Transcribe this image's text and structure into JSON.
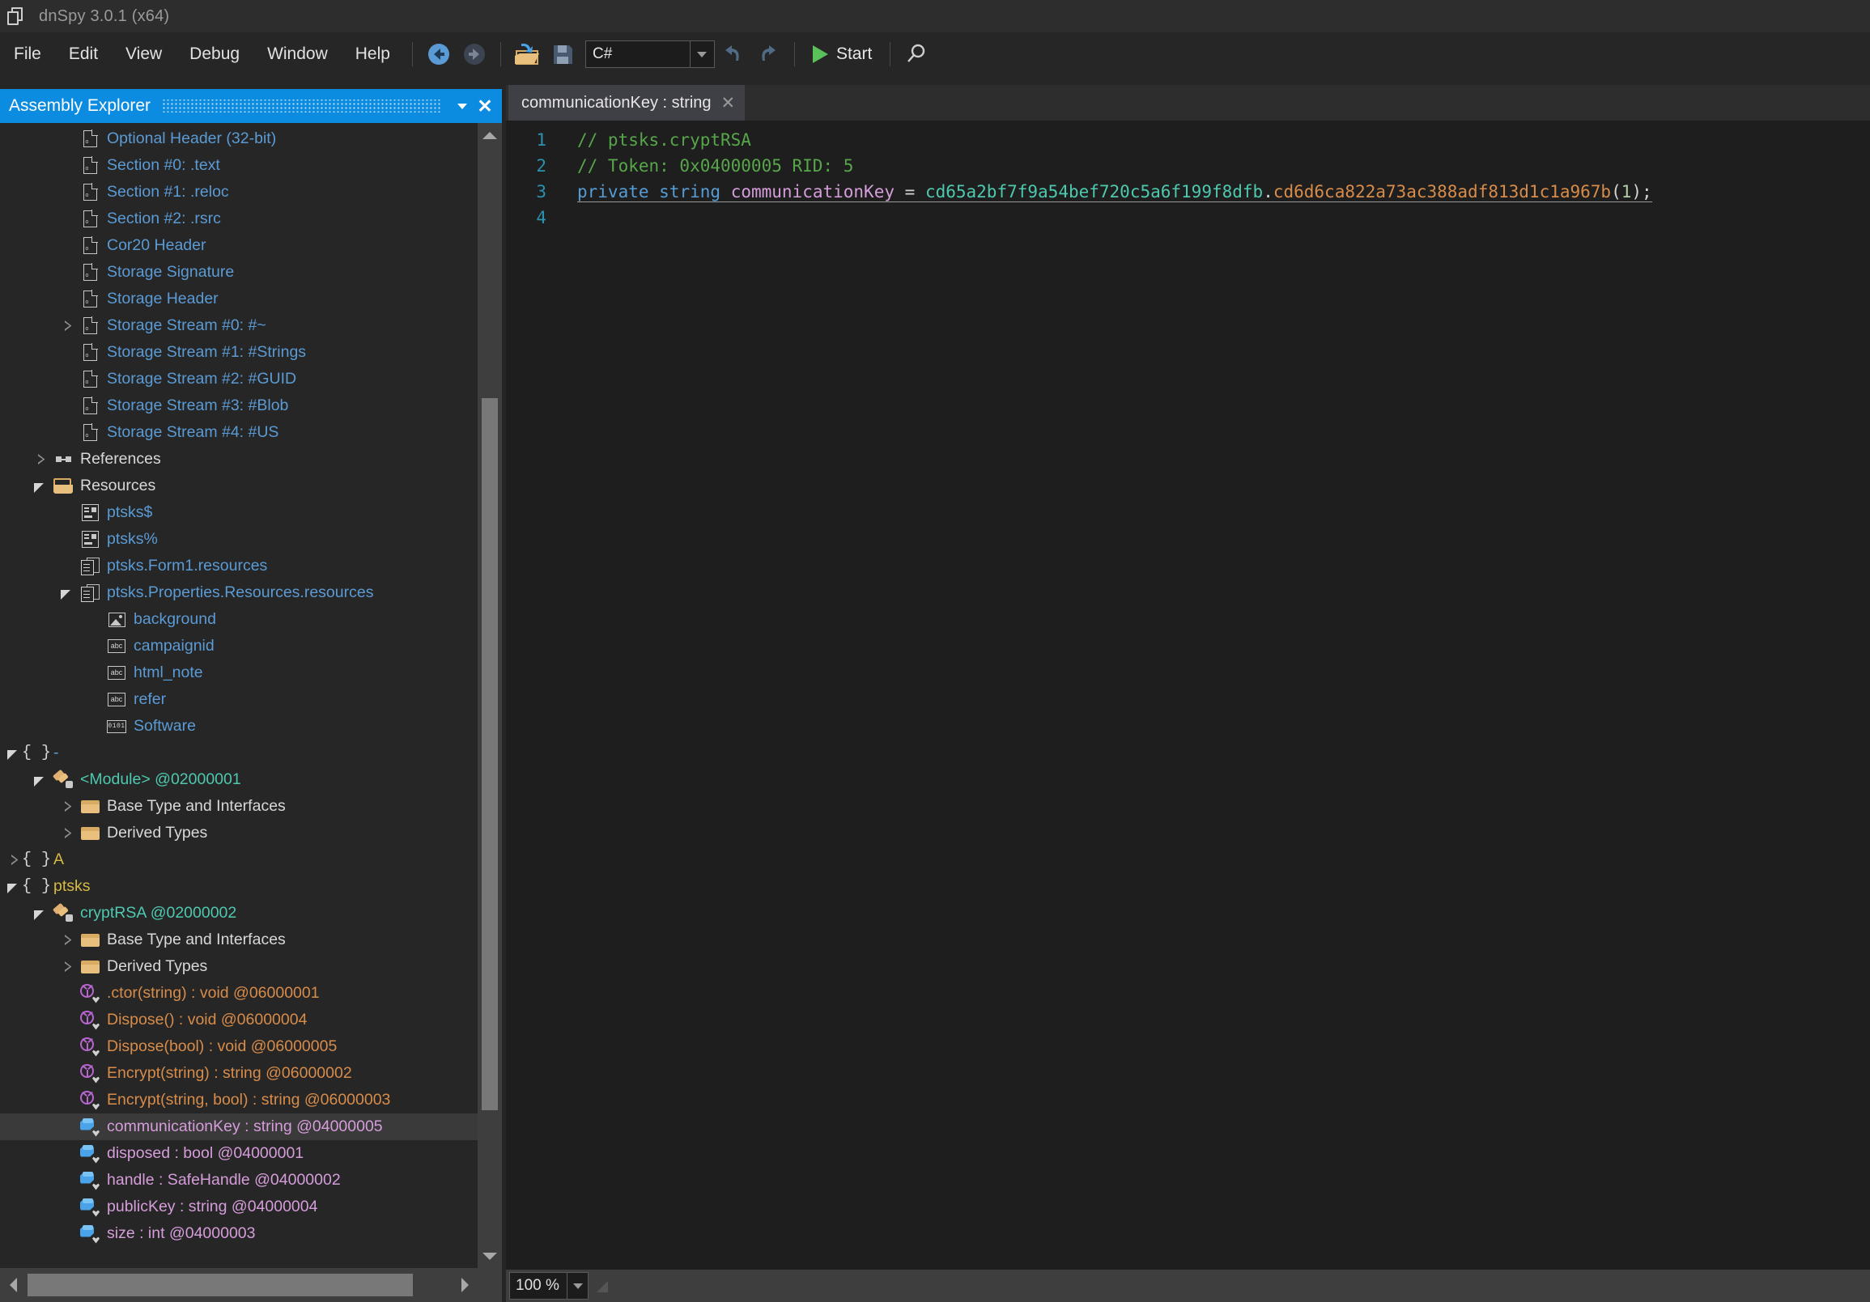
{
  "window": {
    "title": "dnSpy 3.0.1 (x64)",
    "app_icon": "windows-stack-icon"
  },
  "menu": {
    "items": [
      {
        "label": "File"
      },
      {
        "label": "Edit"
      },
      {
        "label": "View"
      },
      {
        "label": "Debug"
      },
      {
        "label": "Window"
      },
      {
        "label": "Help"
      }
    ]
  },
  "toolbar": {
    "back_icon": "back-arrow-icon",
    "forward_icon": "forward-arrow-icon",
    "open_icon": "open-folder-icon",
    "save_icon": "save-disk-icon",
    "language_combo": {
      "value": "C#",
      "caret": "chevron-down-icon"
    },
    "undo_icon": "undo-icon",
    "redo_icon": "redo-icon",
    "start_label": "Start",
    "start_icon": "play-icon",
    "search_icon": "search-icon"
  },
  "left_panel": {
    "title": "Assembly Explorer",
    "menu_icon": "chevron-down-icon",
    "close_icon": "close-icon",
    "tree": [
      {
        "label": "Optional Header (32-bit)",
        "icon": "document-icon",
        "indent": 3,
        "arrow": "none",
        "kind": "doc",
        "color": "#5b9bd5"
      },
      {
        "label": "Section #0: .text",
        "icon": "document-icon",
        "indent": 3,
        "arrow": "none",
        "kind": "doc",
        "color": "#5b9bd5"
      },
      {
        "label": "Section #1: .reloc",
        "icon": "document-icon",
        "indent": 3,
        "arrow": "none",
        "kind": "doc",
        "color": "#5b9bd5"
      },
      {
        "label": "Section #2: .rsrc",
        "icon": "document-icon",
        "indent": 3,
        "arrow": "none",
        "kind": "doc",
        "color": "#5b9bd5"
      },
      {
        "label": "Cor20 Header",
        "icon": "document-icon",
        "indent": 3,
        "arrow": "none",
        "kind": "doc",
        "color": "#5b9bd5"
      },
      {
        "label": "Storage Signature",
        "icon": "document-icon",
        "indent": 3,
        "arrow": "none",
        "kind": "doc",
        "color": "#5b9bd5"
      },
      {
        "label": "Storage Header",
        "icon": "document-icon",
        "indent": 3,
        "arrow": "none",
        "kind": "doc",
        "color": "#5b9bd5"
      },
      {
        "label": "Storage Stream #0: #~",
        "icon": "document-icon",
        "indent": 3,
        "arrow": "collapsed",
        "kind": "doc",
        "color": "#5b9bd5"
      },
      {
        "label": "Storage Stream #1: #Strings",
        "icon": "document-icon",
        "indent": 3,
        "arrow": "none",
        "kind": "doc",
        "color": "#5b9bd5"
      },
      {
        "label": "Storage Stream #2: #GUID",
        "icon": "document-icon",
        "indent": 3,
        "arrow": "none",
        "kind": "doc",
        "color": "#5b9bd5"
      },
      {
        "label": "Storage Stream #3: #Blob",
        "icon": "document-icon",
        "indent": 3,
        "arrow": "none",
        "kind": "doc",
        "color": "#5b9bd5"
      },
      {
        "label": "Storage Stream #4: #US",
        "icon": "document-icon",
        "indent": 3,
        "arrow": "none",
        "kind": "doc",
        "color": "#5b9bd5"
      },
      {
        "label": "References",
        "icon": "references-icon",
        "indent": 2,
        "arrow": "collapsed",
        "kind": "refs",
        "color": "#d8d8d8"
      },
      {
        "label": "Resources",
        "icon": "folder-open-icon",
        "indent": 2,
        "arrow": "expanded",
        "kind": "folderopen",
        "color": "#d8d8d8"
      },
      {
        "label": "ptsks$",
        "icon": "resource-table-icon",
        "indent": 3,
        "arrow": "none",
        "kind": "restable",
        "color": "#5b9bd5"
      },
      {
        "label": "ptsks%",
        "icon": "resource-table-icon",
        "indent": 3,
        "arrow": "none",
        "kind": "restable",
        "color": "#5b9bd5"
      },
      {
        "label": "ptsks.Form1.resources",
        "icon": "multi-document-icon",
        "indent": 3,
        "arrow": "none",
        "kind": "multidoc",
        "color": "#5b9bd5"
      },
      {
        "label": "ptsks.Properties.Resources.resources",
        "icon": "multi-document-icon",
        "indent": 3,
        "arrow": "expanded",
        "kind": "multidoc",
        "color": "#5b9bd5"
      },
      {
        "label": "background",
        "icon": "image-icon",
        "indent": 4,
        "arrow": "none",
        "kind": "image",
        "color": "#5b9bd5"
      },
      {
        "label": "campaignid",
        "icon": "abc-string-icon",
        "indent": 4,
        "arrow": "none",
        "kind": "abc",
        "color": "#5b9bd5"
      },
      {
        "label": "html_note",
        "icon": "abc-string-icon",
        "indent": 4,
        "arrow": "none",
        "kind": "abc",
        "color": "#5b9bd5"
      },
      {
        "label": "refer",
        "icon": "abc-string-icon",
        "indent": 4,
        "arrow": "none",
        "kind": "abc",
        "color": "#5b9bd5"
      },
      {
        "label": "Software",
        "icon": "binary-icon",
        "indent": 4,
        "arrow": "none",
        "kind": "binary",
        "color": "#5b9bd5"
      },
      {
        "label": "-",
        "icon": "namespace-icon",
        "indent": 1,
        "arrow": "expanded",
        "kind": "ns",
        "color": "#5b9bd5"
      },
      {
        "label": "<Module> @02000001",
        "icon": "class-icon",
        "indent": 2,
        "arrow": "expanded",
        "kind": "class",
        "color": "#4ec9b0"
      },
      {
        "label": "Base Type and Interfaces",
        "icon": "folder-icon",
        "indent": 3,
        "arrow": "collapsed",
        "kind": "folder",
        "color": "#d8d8d8"
      },
      {
        "label": "Derived Types",
        "icon": "folder-icon",
        "indent": 3,
        "arrow": "collapsed",
        "kind": "folder",
        "color": "#d8d8d8"
      },
      {
        "label": "A",
        "icon": "namespace-icon",
        "indent": 1,
        "arrow": "collapsed",
        "kind": "ns",
        "color": "#d7ba45"
      },
      {
        "label": "ptsks",
        "icon": "namespace-icon",
        "indent": 1,
        "arrow": "expanded",
        "kind": "ns",
        "color": "#d7ba45"
      },
      {
        "label": "cryptRSA @02000002",
        "icon": "class-icon",
        "indent": 2,
        "arrow": "expanded",
        "kind": "class",
        "color": "#4ec9b0"
      },
      {
        "label": "Base Type and Interfaces",
        "icon": "folder-icon",
        "indent": 3,
        "arrow": "collapsed",
        "kind": "folder",
        "color": "#d8d8d8"
      },
      {
        "label": "Derived Types",
        "icon": "folder-icon",
        "indent": 3,
        "arrow": "collapsed",
        "kind": "folder",
        "color": "#d8d8d8"
      },
      {
        "label": ".ctor(string) : void @06000001",
        "icon": "method-icon",
        "indent": 3,
        "arrow": "none",
        "kind": "method",
        "color": "#d88c4a"
      },
      {
        "label": "Dispose() : void @06000004",
        "icon": "method-icon",
        "indent": 3,
        "arrow": "none",
        "kind": "method",
        "color": "#d88c4a"
      },
      {
        "label": "Dispose(bool) : void @06000005",
        "icon": "method-icon",
        "indent": 3,
        "arrow": "none",
        "kind": "method",
        "color": "#d88c4a"
      },
      {
        "label": "Encrypt(string) : string @06000002",
        "icon": "method-icon",
        "indent": 3,
        "arrow": "none",
        "kind": "method",
        "color": "#d88c4a"
      },
      {
        "label": "Encrypt(string, bool) : string @06000003",
        "icon": "method-icon",
        "indent": 3,
        "arrow": "none",
        "kind": "method",
        "color": "#d88c4a"
      },
      {
        "label": "communicationKey : string @04000005",
        "icon": "field-icon",
        "indent": 3,
        "arrow": "none",
        "kind": "field",
        "color": "#d69ddb",
        "selected": true
      },
      {
        "label": "disposed : bool @04000001",
        "icon": "field-icon",
        "indent": 3,
        "arrow": "none",
        "kind": "field",
        "color": "#d69ddb"
      },
      {
        "label": "handle : SafeHandle @04000002",
        "icon": "field-icon",
        "indent": 3,
        "arrow": "none",
        "kind": "field",
        "color": "#d69ddb"
      },
      {
        "label": "publicKey : string @04000004",
        "icon": "field-icon",
        "indent": 3,
        "arrow": "none",
        "kind": "field",
        "color": "#d69ddb"
      },
      {
        "label": "size : int @04000003",
        "icon": "field-icon",
        "indent": 3,
        "arrow": "none",
        "kind": "field",
        "color": "#d69ddb"
      }
    ],
    "vscroll": {
      "up_icon": "scroll-up-icon",
      "down_icon": "scroll-down-icon"
    },
    "hscroll": {
      "left_icon": "scroll-left-icon",
      "right_icon": "scroll-right-icon"
    }
  },
  "editor": {
    "tab": {
      "label": "communicationKey : string",
      "close_icon": "close-icon"
    },
    "lines": [
      {
        "num": "1",
        "text": "// ptsks.cryptRSA"
      },
      {
        "num": "2",
        "text": "// Token: 0x04000005 RID: 5"
      },
      {
        "num": "3",
        "text": "private string communicationKey = cd65a2bf7f9a54bef720c5a6f199f8dfb.cd6d6ca822a73ac388adf813d1c1a967b(1);"
      },
      {
        "num": "4",
        "text": ""
      }
    ],
    "code": {
      "l1": "// ptsks.cryptRSA",
      "l2": "// Token: 0x04000005 RID: 5",
      "l3_kw1": "private",
      "l3_kw2": "string",
      "l3_field": "communicationKey",
      "l3_eq": "=",
      "l3_type": "cd65a2bf7f9a54bef720c5a6f199f8dfb",
      "l3_dot": ".",
      "l3_method": "cd6d6ca822a73ac388adf813d1c1a967b",
      "l3_open": "(",
      "l3_arg": "1",
      "l3_tail": ");",
      "n1": "1",
      "n2": "2",
      "n3": "3",
      "n4": "4"
    }
  },
  "statusbar": {
    "zoom": "100 %",
    "zoom_caret": "chevron-down-icon"
  },
  "colors": {
    "accent": "#0c8ce0",
    "panel_bg": "#262626",
    "editor_bg": "#1e1e1e",
    "comment": "#57a64a",
    "keyword": "#569cd6",
    "type": "#4ec9b0",
    "method": "#d88c4a",
    "field": "#d69ddb",
    "linenum": "#2b91af",
    "start_green": "#5ac05a"
  }
}
